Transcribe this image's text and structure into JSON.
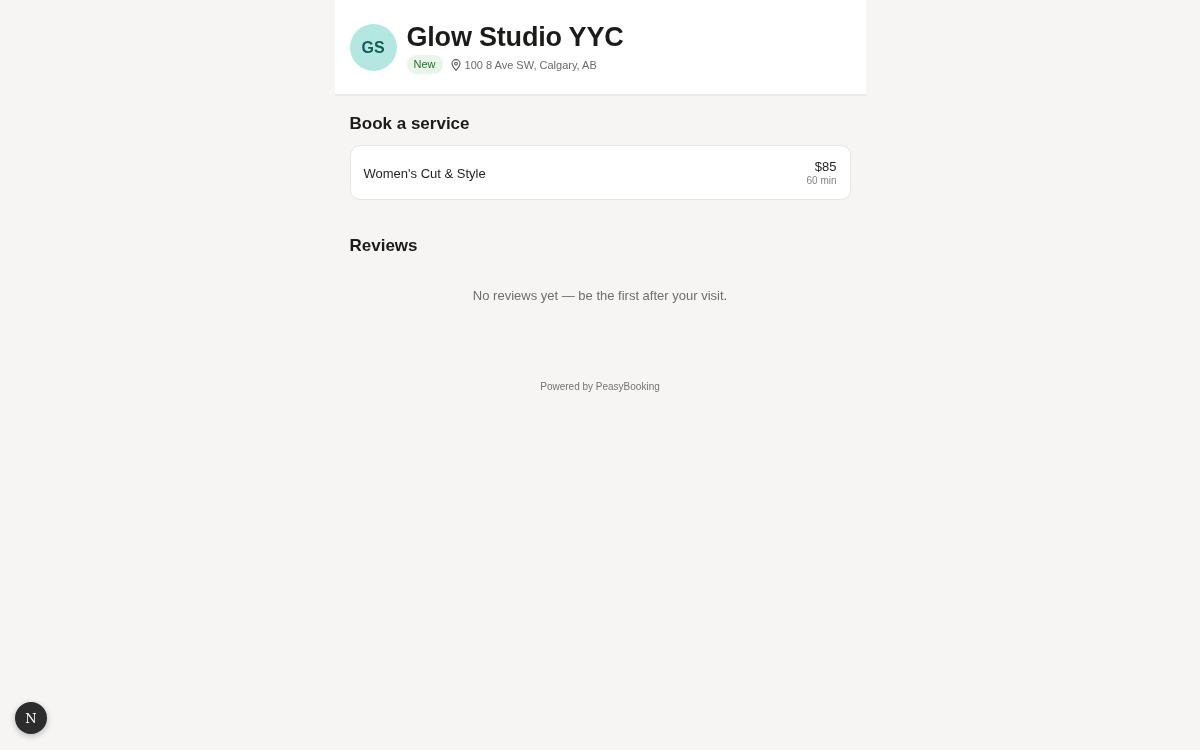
{
  "business": {
    "initials": "GS",
    "name": "Glow Studio YYC",
    "badge": "New",
    "address": "100 8 Ave SW, Calgary, AB"
  },
  "services": {
    "title": "Book a service",
    "items": [
      {
        "name": "Women's Cut & Style",
        "price": "$85",
        "duration": "60 min"
      }
    ]
  },
  "reviews": {
    "title": "Reviews",
    "empty_message": "No reviews yet — be the first after your visit."
  },
  "footer": {
    "text": "Powered by PeasyBooking"
  },
  "dev_indicator": {
    "label": "N"
  }
}
